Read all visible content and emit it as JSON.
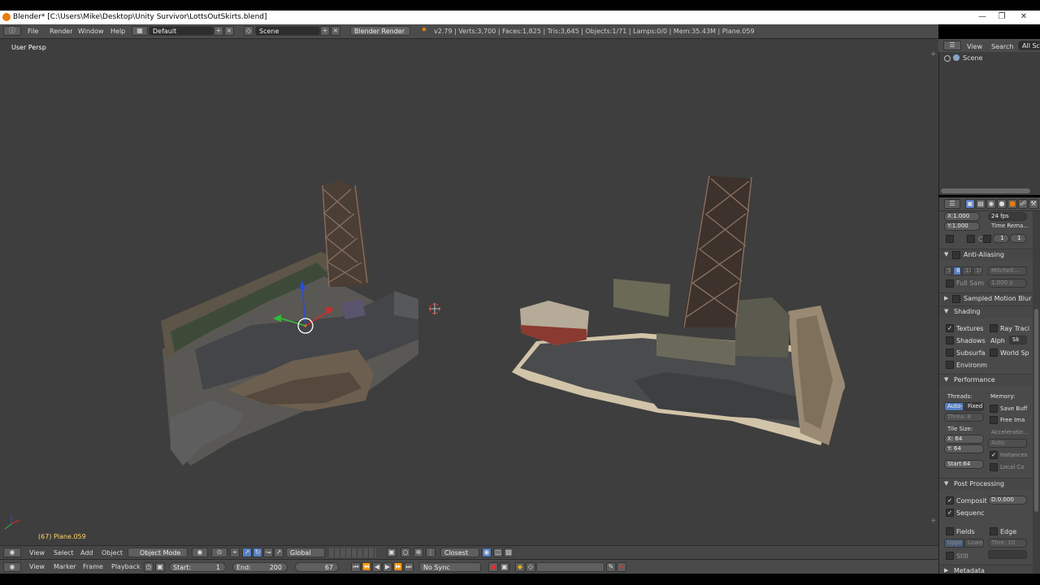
{
  "window": {
    "title": "Blender* [C:\\Users\\Mike\\Desktop\\Unity Survivor\\LottsOutSkirts.blend]"
  },
  "info_bar": {
    "menus": [
      "File",
      "Render",
      "Window",
      "Help"
    ],
    "layout": "Default",
    "scene": "Scene",
    "engine": "Blender Render",
    "stats": "v2.79 | Verts:3,700 | Faces:1,825 | Tris:3,645 | Objects:1/71 | Lamps:0/0 | Mem:35.43M | Plane.059"
  },
  "viewport": {
    "view_label": "User Persp",
    "object_label": "(67) Plane.059"
  },
  "header_3d": {
    "menus": [
      "View",
      "Select",
      "Add",
      "Object"
    ],
    "mode": "Object Mode",
    "orientation": "Global",
    "snap": "Closest"
  },
  "timeline": {
    "menus": [
      "View",
      "Marker",
      "Frame",
      "Playback"
    ],
    "start_label": "Start:",
    "start_value": "1",
    "end_label": "End:",
    "end_value": "200",
    "current": "67",
    "sync": "No Sync"
  },
  "outliner": {
    "menus": [
      "View",
      "Search",
      "All Sc"
    ],
    "scene_item": "Scene"
  },
  "properties": {
    "res_x": "X:1.000",
    "res_y": "Y:1.000",
    "fps": "24 fps",
    "time_remap": "Time Rema...",
    "c_label": "C",
    "remap_a": "1",
    "remap_b": "1",
    "anti_aliasing": "Anti-Aliasing",
    "aa_samples": [
      "5",
      "8",
      "11",
      "16"
    ],
    "aa_filter": "Mitchell...",
    "full_sample": "Full Sam",
    "aa_size": "1.000 p",
    "motion_blur": "Sampled Motion Blur",
    "shading": "Shading",
    "textures": "Textures",
    "ray_tracing": "Ray Traci",
    "shadows": "Shadows",
    "alpha_label": "Alph",
    "alpha_value": "Sk",
    "subsurface": "Subsurfa",
    "world_space": "World Sp",
    "environment": "Environm",
    "performance": "Performance",
    "threads": "Threads:",
    "memory": "Memory:",
    "auto_detect": "Auto-d",
    "fixed": "Fixed",
    "save_buffers": "Save Buff",
    "thread_count": "Threa: 8",
    "free_images": "Free Ima",
    "acceleration": "Acceleratio...",
    "tile_size": "Tile Size:",
    "tile_x": "X:  64",
    "tile_y": "Y:  64",
    "tile_auto": "Auto",
    "instances": "Instances",
    "start_tile": "Start:64",
    "local_coords": "Local Co",
    "post_processing": "Post Processing",
    "compositing": "Composit",
    "dither": "D:0.000",
    "sequencer": "Sequenc",
    "fields": "Fields",
    "edge": "Edge",
    "upper": "Upper",
    "lower": "Lower",
    "threshold": "Thre: 10",
    "still": "Still",
    "metadata": "Metadata"
  }
}
